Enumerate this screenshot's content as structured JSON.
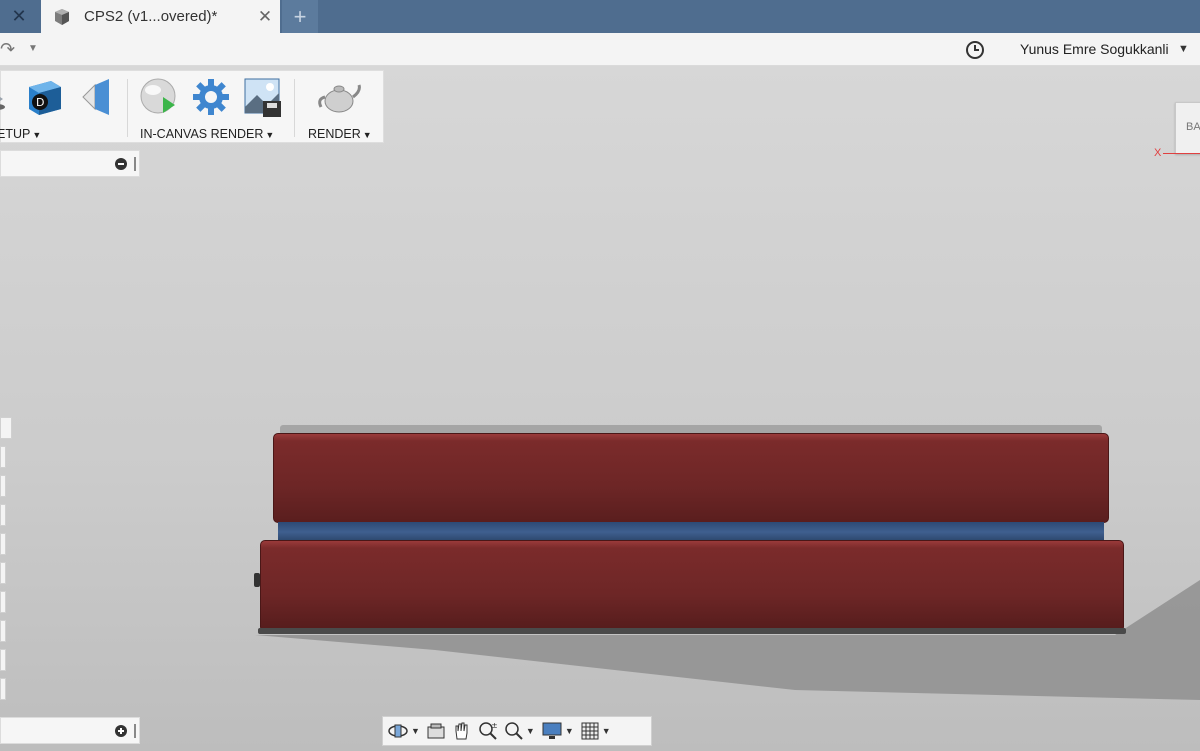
{
  "tabs": {
    "prev_close": "✕",
    "active": {
      "title": "CPS2 (v1...overed)*",
      "close": "✕"
    },
    "new_tab": "+"
  },
  "appbar": {
    "username": "Yunus Emre Sogukkanli"
  },
  "toolbar": {
    "groups": [
      {
        "label": "ETUP"
      },
      {
        "label": "IN-CANVAS RENDER"
      },
      {
        "label": "RENDER"
      }
    ]
  },
  "viewcube": {
    "face": "BA",
    "axis": "X"
  },
  "navbar": {
    "tools": [
      "orbit-icon",
      "look-at-icon",
      "pan-icon",
      "zoom-icon",
      "fit-icon",
      "display-settings-icon",
      "grid-icon"
    ]
  },
  "colors": {
    "tabbar": "#4f6d8f",
    "model_red": "#6d2626",
    "seal_blue": "#3f5f8f"
  }
}
